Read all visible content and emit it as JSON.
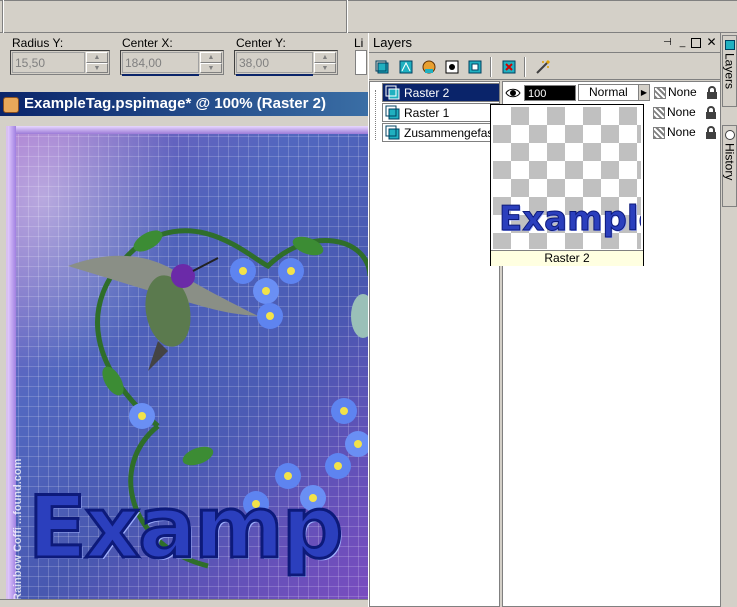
{
  "toolbar": {
    "fields": [
      {
        "label": "Radius Y:",
        "value": "15,50"
      },
      {
        "label": "Center X:",
        "value": "184,00"
      },
      {
        "label": "Center Y:",
        "value": "38,00"
      }
    ],
    "cut_label": "Li"
  },
  "document": {
    "title": "ExampleTag.pspimage* @ 100% (Raster 2)",
    "artwork_text": "Examp",
    "copyright_text": "© Rainbow Coffi  ...found.com"
  },
  "layers_palette": {
    "title": "Layers",
    "layers": [
      {
        "name": "Raster 2",
        "selected": true
      },
      {
        "name": "Raster 1",
        "selected": false
      },
      {
        "name": "Zusammengefasst",
        "selected": false
      }
    ],
    "properties": [
      {
        "opacity": "100",
        "blend": "Normal",
        "mask": "None"
      },
      {
        "opacity": "",
        "blend": "",
        "mask": "None"
      },
      {
        "opacity": "",
        "blend": "",
        "mask": "None"
      }
    ],
    "preview": {
      "text": "Example",
      "caption": "Raster 2"
    }
  },
  "side_tabs": {
    "layers": "Layers",
    "history": "History"
  },
  "colors": {
    "selection": "#0a246a",
    "titlebar_start": "#0a246a",
    "titlebar_end": "#3a6ea5",
    "panel_bg": "#d4d0c8",
    "artwork_text": "#2b3fbd"
  }
}
